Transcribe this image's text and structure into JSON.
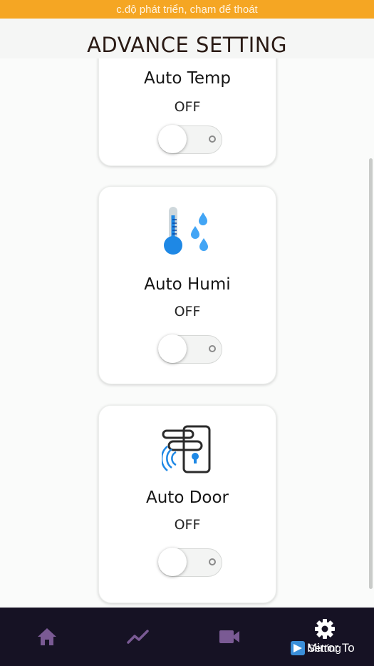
{
  "status_banner": {
    "text": "c.độ phát triển, chạm để thoát"
  },
  "header": {
    "title": "ADVANCE SETTING"
  },
  "cards": [
    {
      "label": "Auto Temp",
      "state": "OFF",
      "icon": "thermometer-icon",
      "enabled": false
    },
    {
      "label": "Auto Humi",
      "state": "OFF",
      "icon": "thermometer-droplets-icon",
      "enabled": false
    },
    {
      "label": "Auto Door",
      "state": "OFF",
      "icon": "smart-door-lock-icon",
      "enabled": false
    }
  ],
  "colors": {
    "banner": "#f5a623",
    "nav_background": "#161224",
    "nav_icon_inactive": "#7a5a94",
    "nav_icon_active": "#ffffff",
    "thermo_blue": "#1e88e5",
    "droplet_blue": "#42a5f5"
  },
  "bottom_nav": {
    "items": [
      {
        "icon": "home-icon",
        "active": false
      },
      {
        "icon": "chart-line-icon",
        "active": false
      },
      {
        "icon": "video-camera-icon",
        "active": false
      },
      {
        "icon": "gear-icon",
        "label": "Setting",
        "active": true
      }
    ]
  },
  "watermark": {
    "text": "Mirror To"
  }
}
